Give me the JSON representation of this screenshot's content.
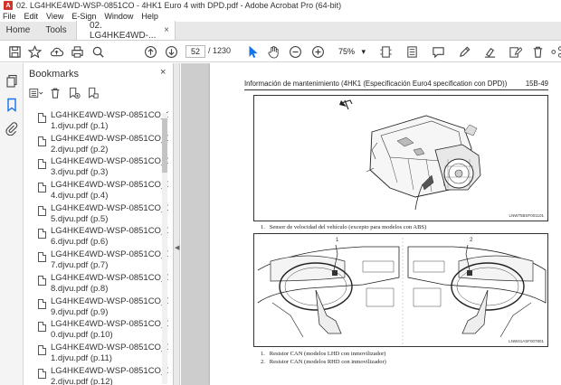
{
  "window": {
    "title": "02. LG4HKE4WD-WSP-0851CO - 4HK1 Euro 4 with DPD.pdf - Adobe Acrobat Pro (64-bit)",
    "app_icon_text": "A"
  },
  "menu": [
    "File",
    "Edit",
    "View",
    "E-Sign",
    "Window",
    "Help"
  ],
  "tabs": {
    "home": "Home",
    "tools": "Tools",
    "doc": "02. LG4HKE4WD-...",
    "close": "×"
  },
  "toolbar": {
    "page_current": "52",
    "page_total": "/ 1230",
    "zoom": "75%",
    "zoom_caret": "▾"
  },
  "bookmarks": {
    "header": "Bookmarks",
    "close": "×",
    "items": [
      {
        "l1": "LG4HKE4WD-WSP-0851CO_000",
        "l2": "1.djvu.pdf (p.1)"
      },
      {
        "l1": "LG4HKE4WD-WSP-0851CO_000",
        "l2": "2.djvu.pdf (p.2)"
      },
      {
        "l1": "LG4HKE4WD-WSP-0851CO_000",
        "l2": "3.djvu.pdf (p.3)"
      },
      {
        "l1": "LG4HKE4WD-WSP-0851CO_000",
        "l2": "4.djvu.pdf (p.4)"
      },
      {
        "l1": "LG4HKE4WD-WSP-0851CO_000",
        "l2": "5.djvu.pdf (p.5)"
      },
      {
        "l1": "LG4HKE4WD-WSP-0851CO_000",
        "l2": "6.djvu.pdf (p.6)"
      },
      {
        "l1": "LG4HKE4WD-WSP-0851CO_000",
        "l2": "7.djvu.pdf (p.7)"
      },
      {
        "l1": "LG4HKE4WD-WSP-0851CO_000",
        "l2": "8.djvu.pdf (p.8)"
      },
      {
        "l1": "LG4HKE4WD-WSP-0851CO_000",
        "l2": "9.djvu.pdf (p.9)"
      },
      {
        "l1": "LG4HKE4WD-WSP-0851CO_001",
        "l2": "0.djvu.pdf (p.10)"
      },
      {
        "l1": "LG4HKE4WD-WSP-0851CO_001",
        "l2": "1.djvu.pdf (p.11)"
      },
      {
        "l1": "LG4HKE4WD-WSP-0851CO_001",
        "l2": "2.djvu.pdf (p.12)"
      }
    ]
  },
  "document": {
    "header_title": "Información de mantenimiento (4HK1 (Especificación Euro4 specification con DPD))",
    "header_page": "15B-49",
    "fig1_code": "LNW75BSF001101",
    "fig1_caption_num": "1.",
    "fig1_caption": "Sensor de velocidad del vehículo (excepto para modelos con ABS)",
    "fig2_code": "LNW41ASF007801",
    "fig2_caption1_num": "1.",
    "fig2_caption1": "Resistor CAN (modelos LHD con inmovilizador)",
    "fig2_caption2_num": "2.",
    "fig2_caption2": "Resistor CAN (modelos RHD con inmovilizador)",
    "callout_1": "1",
    "callout_2": "2"
  },
  "colors": {
    "accent": "#1473e6",
    "acrobat_red": "#d0332a"
  }
}
